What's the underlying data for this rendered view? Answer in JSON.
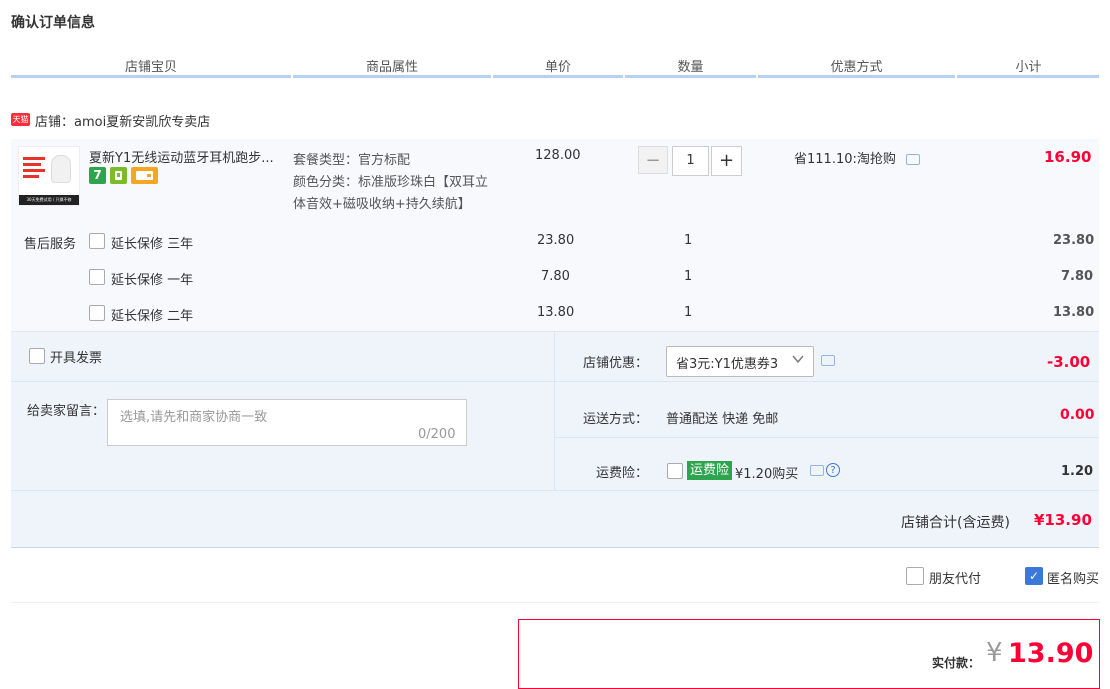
{
  "page": {
    "title": "确认订单信息"
  },
  "columns": [
    "店铺宝贝",
    "商品属性",
    "单价",
    "数量",
    "优惠方式",
    "小计"
  ],
  "shop": {
    "badge": "天猫",
    "label": "店铺：amoi夏新安凯欣专卖店"
  },
  "product": {
    "title": "夏新Y1无线运动蓝牙耳机跑步...",
    "attr_package": "套餐类型：官方标配",
    "attr_color_line1": "颜色分类：标准版珍珠白【双耳立",
    "attr_color_line2": "体音效+磁吸收纳+持久续航】",
    "unit_price": "128.00",
    "quantity": "1",
    "quantity_minus": "−",
    "quantity_plus": "+",
    "discount": "省111.10:淘抢购",
    "subtotal": "16.90",
    "thumb_strip_text": "30天免费试用 / 只换不修"
  },
  "service": {
    "label": "售后服务",
    "items": [
      {
        "name": "延长保修 三年",
        "price": "23.80",
        "qty": "1",
        "subtotal": "23.80"
      },
      {
        "name": "延长保修 一年",
        "price": "7.80",
        "qty": "1",
        "subtotal": "7.80"
      },
      {
        "name": "延长保修 二年",
        "price": "13.80",
        "qty": "1",
        "subtotal": "13.80"
      }
    ]
  },
  "invoice": {
    "label": "开具发票"
  },
  "memo": {
    "label": "给卖家留言：",
    "placeholder": "选填,请先和商家协商一致",
    "count": "0/200"
  },
  "shop_coupon": {
    "label": "店铺优惠：",
    "selected": "省3元:Y1优惠券3",
    "amount": "-3.00"
  },
  "shipping": {
    "label": "运送方式：",
    "method": "普通配送 快递 免邮",
    "amount": "0.00"
  },
  "insurance": {
    "label": "运费险：",
    "badge": "运费险",
    "text": "¥1.20购买",
    "amount": "1.20"
  },
  "shop_total": {
    "label": "店铺合计(含运费)",
    "amount": "¥13.90"
  },
  "options": {
    "friend_pay": "朋友代付",
    "anonymous": "匿名购买"
  },
  "payment": {
    "label": "实付款：",
    "currency": "¥",
    "amount": "13.90"
  },
  "colors": {
    "accent": "#ff0036",
    "header_line": "#b6d0ef",
    "panel_bg": "#eff4fb",
    "checkbox_blue": "#3c78d8",
    "insure_green": "#2ea44f"
  }
}
